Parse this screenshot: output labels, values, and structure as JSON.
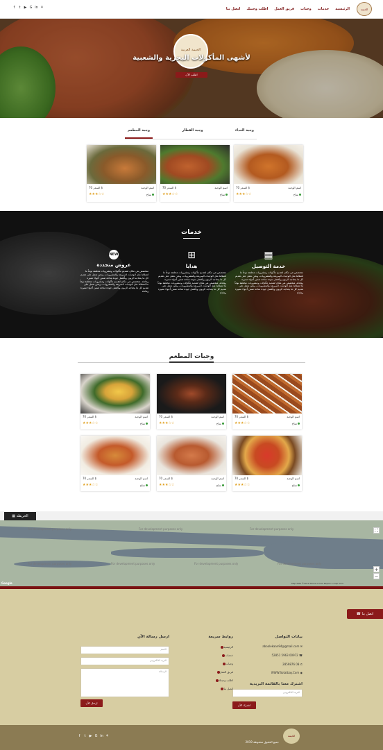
{
  "brand": {
    "logo_text": "الخيمة"
  },
  "nav": {
    "items": [
      "الرئيسية",
      "خدمات",
      "وجبات",
      "فريق العمل",
      "اطلب وجبتك",
      "اتصل بنا"
    ]
  },
  "social": [
    "f",
    "t",
    "▶",
    "G",
    "in",
    "⚘"
  ],
  "hero": {
    "title": "لأشهى المأكولات البحرية والشعبية",
    "button": "اطلب الآن",
    "logo_text": "الخيمة العربية"
  },
  "tabs": {
    "items": [
      "وجبة الغداء",
      "وجبة الفطار",
      "وجبة المطعم"
    ],
    "active": 2
  },
  "card_text": {
    "name": "اسم الوجبة",
    "price": "السعر 70 $",
    "avail": "متاح",
    "stars": "★★★☆☆"
  },
  "services": {
    "title": "خدمات",
    "items": [
      {
        "icon": "▦",
        "title": "خدمة التوصيل",
        "text": "متخصص هي مكان لتقديم مأكولات ومشروبات مخلتفة نوعاً ما لعملائنا مثل الوجبات السريعة والمشروبات، ونحن نعمل على تقديم كل ما يحتاجه الزبون وبأفضل جودة متاحة ضمن أجواء مميزة وهادئة، متخصص هي مكان لتقديم مأكولات ومشروبات مختلفة نوعاً ما لعملائنا مثل الوجبات السريعة والمشروبات، ونحن نعمل على تقديم كل ما يحتاجه الزبون وبأفضل جودة متاحة ضمن أجواء مميزة وهادئة"
      },
      {
        "icon": "⊞",
        "title": "هدايا",
        "text": "متخصص هي مكان لتقديم مأكولات ومشروبات مخلتفة نوعاً ما لعملائنا مثل الوجبات السريعة والمشروبات، ونحن نعمل على تقديم كل ما يحتاجه الزبون وبأفضل جودة متاحة ضمن أجواء مميزة وهادئة، متخصص هي مكان لتقديم مأكولات ومشروبات مختلفة نوعاً ما لعملائنا مثل الوجبات السريعة والمشروبات، ونحن نعمل على تقديم كل ما يحتاجه الزبون وبأفضل جودة متاحة ضمن أجواء مميزة وهادئة"
      },
      {
        "icon": "NEW",
        "title": "عروض متجددة",
        "text": "متخصص هي مكان لتقديم مأكولات ومشروبات مخلتفة نوعاً ما لعملائنا مثل الوجبات السريعة والمشروبات، ونحن نعمل على تقديم كل ما يحتاجه الزبون وبأفضل جودة متاحة ضمن أجواء مميزة وهادئة، متخصص هي مكان لتقديم مأكولات ومشروبات مختلفة نوعاً ما لعملائنا مثل الوجبات السريعة والمشروبات، ونحن نعمل على تقديم كل ما يحتاجه الزبون وبأفضل جودة متاحة ضمن أجواء مميزة وهادئة"
      }
    ]
  },
  "menu2": {
    "title": "وجبات المطعم"
  },
  "map": {
    "tab": "الخريطة",
    "watermark": "For development purposes only",
    "google": "Google",
    "terms": "Map data ©2019  Terms of Use  Report a map error"
  },
  "contact": {
    "button": "اتصل بنا"
  },
  "footer": {
    "contact_title": "بيانات التواصل",
    "email": "aboalekaan94@gmail.com",
    "phone1": "00972 5963 52851",
    "phone2": "08 2859876",
    "site": "WWW.Sotatbay.Com",
    "newsletter_title": "اشترك معنا بالقائمة البريدية",
    "newsletter_placeholder": "البريد الالكتروني",
    "newsletter_button": "اشترك الآن",
    "links_title": "روابط سريعة",
    "links": [
      "الرئيسية",
      "خدمات",
      "وجبات",
      "فريق العمل",
      "اطلب وجبتك",
      "اتصل بنا"
    ],
    "message_title": "ارسل رسالة الآن",
    "name_ph": "الاسم",
    "email_ph": "البريد الالكتروني",
    "msg_ph": "الرسالة",
    "send": "ارسل الآن"
  },
  "bottom": {
    "copyright": "جميع الحقوق محفوظة 2019",
    "logo_text": "الخيمة"
  }
}
